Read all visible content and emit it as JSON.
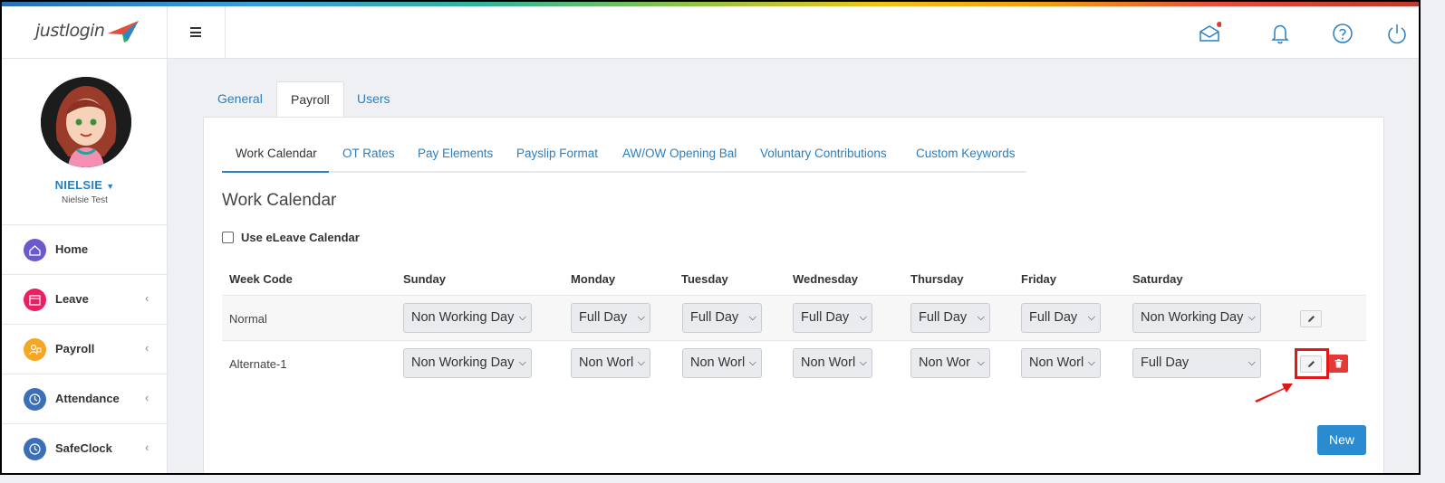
{
  "brand": {
    "logo_text": "justlogin"
  },
  "topbar": {
    "icons": [
      "inbox-icon",
      "bell-icon",
      "help-icon",
      "power-icon"
    ],
    "notification_color": "#e53935"
  },
  "user": {
    "name": "NIELSIE",
    "subtitle": "Nielsie Test"
  },
  "sidebar": {
    "items": [
      {
        "label": "Home",
        "icon": "home-icon",
        "color": "#6a5acd",
        "chevron": ""
      },
      {
        "label": "Leave",
        "icon": "calendar-icon",
        "color": "#e91e63",
        "chevron": "‹"
      },
      {
        "label": "Payroll",
        "icon": "payroll-icon",
        "color": "#f5a623",
        "chevron": "‹"
      },
      {
        "label": "Attendance",
        "icon": "clock-icon",
        "color": "#3b6fb6",
        "chevron": "‹"
      },
      {
        "label": "SafeClock",
        "icon": "safeclock-icon",
        "color": "#3b6fb6",
        "chevron": "‹"
      }
    ]
  },
  "tabs": [
    "General",
    "Payroll",
    "Users"
  ],
  "subtabs": [
    "Work Calendar",
    "OT Rates",
    "Pay Elements",
    "Payslip Format",
    "AW/OW Opening Bal",
    "Voluntary Contributions",
    "Custom Keywords"
  ],
  "section": {
    "title": "Work Calendar",
    "checkbox_label": "Use eLeave Calendar"
  },
  "table": {
    "headers": [
      "Week Code",
      "Sunday",
      "Monday",
      "Tuesday",
      "Wednesday",
      "Thursday",
      "Friday",
      "Saturday"
    ],
    "rows": [
      {
        "code": "Normal",
        "days": [
          "Non Working Day",
          "Full Day",
          "Full Day",
          "Full Day",
          "Full Day",
          "Full Day",
          "Non Working Day"
        ]
      },
      {
        "code": "Alternate-1",
        "days": [
          "Non Working Day",
          "Non Worl",
          "Non Worl",
          "Non Worl",
          "Non Wor",
          "Non Worl",
          "Full Day"
        ]
      }
    ]
  },
  "actions": {
    "new_label": "New",
    "accent_color": "#2a8bd0",
    "highlight_color": "#e01818"
  }
}
